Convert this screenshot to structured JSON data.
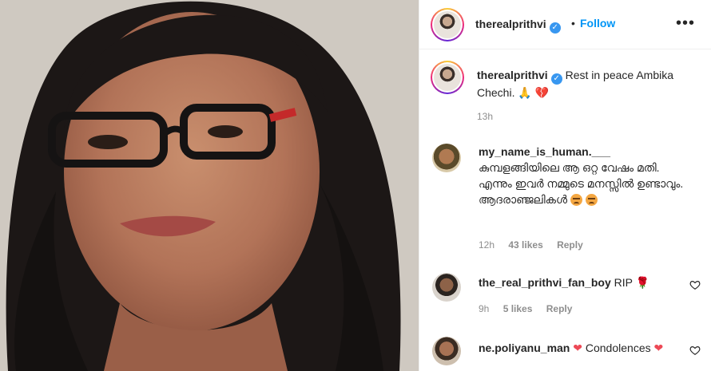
{
  "header": {
    "username": "therealprithvi",
    "verified_mark": "✓",
    "separator": "•",
    "follow_label": "Follow",
    "more_label": "•••"
  },
  "caption": {
    "username": "therealprithvi",
    "verified_mark": "✓",
    "text": "Rest in peace Ambika Chechi.",
    "emoji_pray": "🙏",
    "emoji_heart": "💔",
    "time": "13h"
  },
  "comments": [
    {
      "username": "my_name_is_human.___",
      "text": "കുമ്പളങ്ങിയിലെ ആ ഒറ്റ വേഷം മതി. എന്നും ഇവർ നമ്മുടെ മനസ്സിൽ ഉണ്ടാവും. ആദരാഞ്ജലികൾ",
      "time": "12h",
      "likes": "43 likes",
      "reply": "Reply"
    },
    {
      "username": "the_real_prithvi_fan_boy",
      "text": "RIP",
      "emoji": "🌹",
      "time": "9h",
      "likes": "5 likes",
      "reply": "Reply"
    },
    {
      "username": "ne.poliyanu_man",
      "text": "Condolences",
      "emoji": "❤",
      "time": "",
      "likes": "",
      "reply": ""
    }
  ],
  "icons": {
    "verified": "verified-badge-icon",
    "like": "heart-outline-icon",
    "more": "more-horizontal-icon"
  },
  "colors": {
    "accent": "#0095f6",
    "verified": "#3897f0",
    "secondary_text": "#8e8e8e",
    "heart_red": "#ed4956"
  }
}
